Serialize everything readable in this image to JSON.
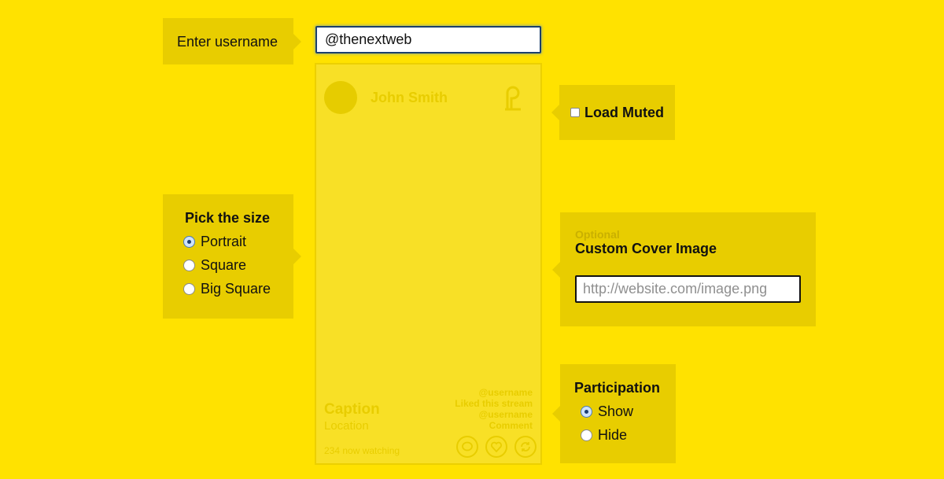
{
  "username": {
    "label": "Enter username",
    "value": "@thenextweb"
  },
  "preview": {
    "name": "John Smith",
    "caption": "Caption",
    "location": "Location",
    "watching": "234 now watching",
    "feed": [
      "@username",
      "Liked this stream",
      "@username",
      "Comment"
    ],
    "logo_icon": "periscope-logo-icon",
    "action_icons": [
      "chat-icon",
      "heart-icon",
      "share-icon"
    ]
  },
  "load_muted": {
    "label": "Load Muted",
    "checked": false
  },
  "size": {
    "title": "Pick the size",
    "options": [
      "Portrait",
      "Square",
      "Big Square"
    ],
    "selected": "Portrait"
  },
  "cover": {
    "optional_label": "Optional",
    "title": "Custom Cover Image",
    "placeholder": "http://website.com/image.png"
  },
  "participation": {
    "title": "Participation",
    "options": [
      "Show",
      "Hide"
    ],
    "selected": "Show"
  },
  "colors": {
    "background": "#ffe200",
    "panel": "#e8cd00",
    "preview_card": "#f8e026"
  }
}
